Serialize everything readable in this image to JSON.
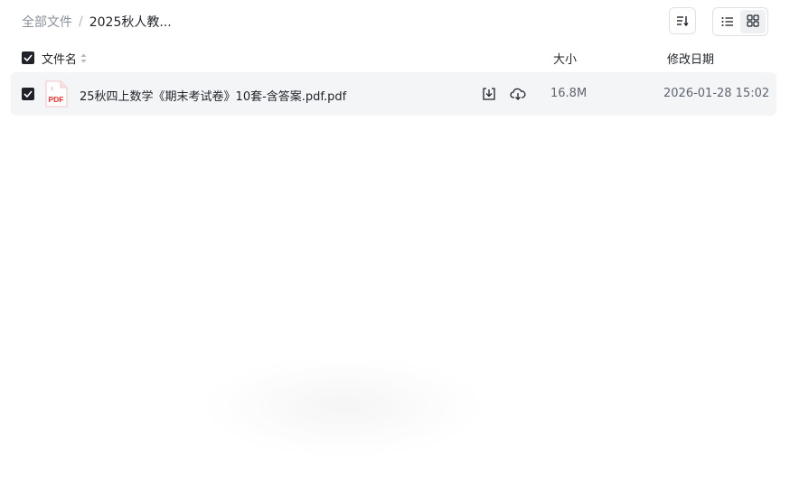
{
  "breadcrumb": {
    "root": "全部文件",
    "separator": "/",
    "current": "2025秋人教..."
  },
  "toolbar": {
    "sort_icon": "sort-icon",
    "list_view_icon": "list-view-icon",
    "grid_view_icon": "grid-view-icon"
  },
  "table": {
    "columns": {
      "name": "文件名",
      "size": "大小",
      "modified": "修改日期"
    },
    "rows": [
      {
        "icon": "pdf-file-icon",
        "icon_label": "PDF",
        "name": "25秋四上数学《期末考试卷》10套-含答案.pdf.pdf",
        "size": "16.8M",
        "modified": "2026-01-28 15:02",
        "selected": true
      }
    ]
  },
  "colors": {
    "text_primary": "#1f2329",
    "text_secondary": "#5f6570",
    "muted": "#8a8f99",
    "row_bg": "#f4f5f6",
    "pdf_red": "#e53935",
    "checkbox": "#1f2329"
  }
}
